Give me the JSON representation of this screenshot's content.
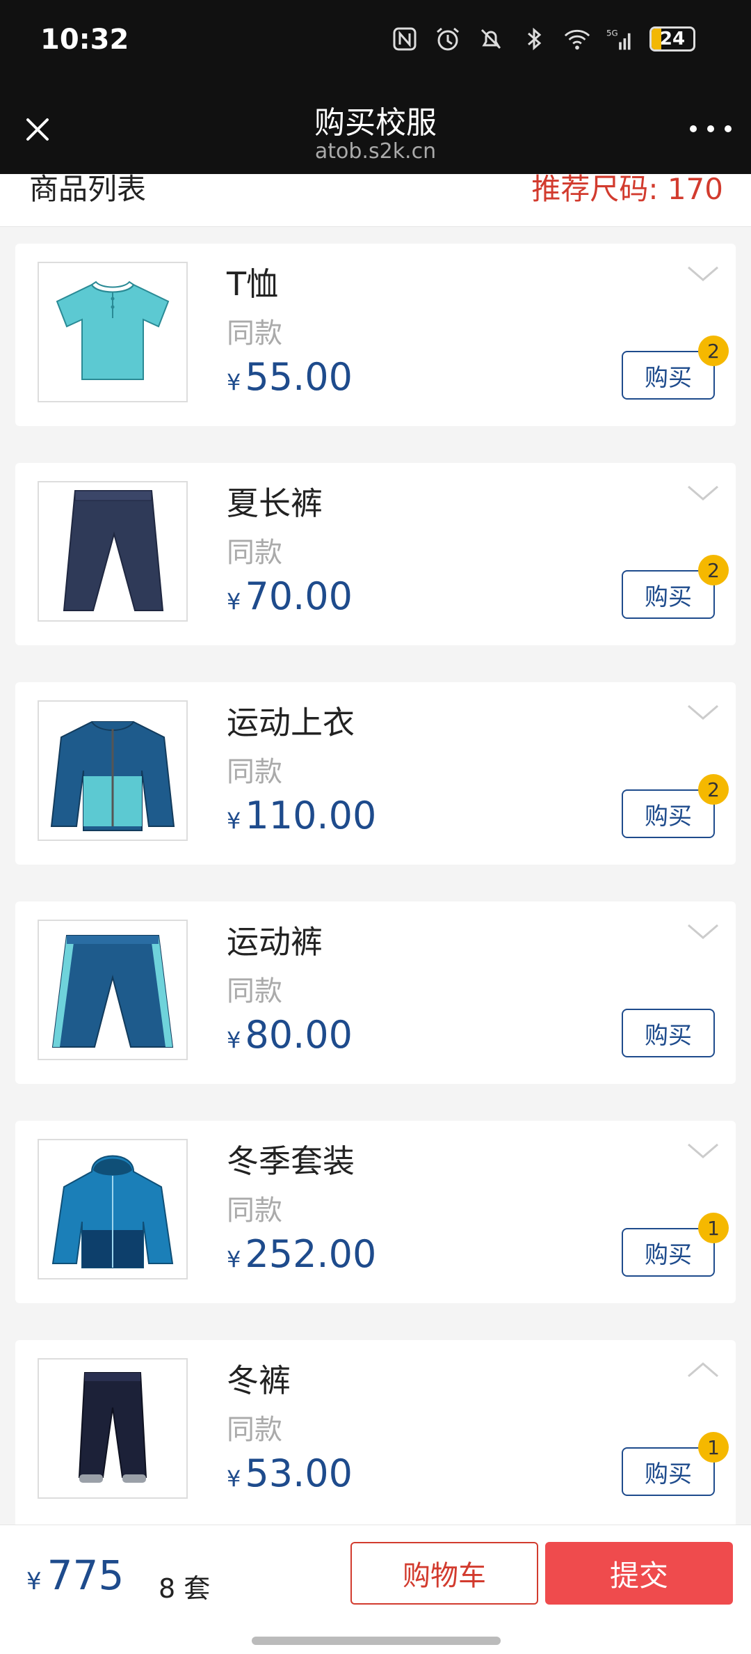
{
  "status_bar": {
    "time": "10:32",
    "battery": "24",
    "battery_level": 0.24,
    "icons": [
      "nfc-icon",
      "alarm-icon",
      "mute-icon",
      "bluetooth-icon",
      "wifi-icon",
      "signal-5g-icon"
    ]
  },
  "nav": {
    "title": "购买校服",
    "subtitle": "atob.s2k.cn"
  },
  "section": {
    "left": "商品列表",
    "right": "推荐尺码: 170"
  },
  "products": [
    {
      "name": "T恤",
      "variant": "同款",
      "currency": "¥",
      "price": "55.00",
      "buy": "购买",
      "badge": "2",
      "expanded": false
    },
    {
      "name": "夏长裤",
      "variant": "同款",
      "currency": "¥",
      "price": "70.00",
      "buy": "购买",
      "badge": "2",
      "expanded": false
    },
    {
      "name": "运动上衣",
      "variant": "同款",
      "currency": "¥",
      "price": "110.00",
      "buy": "购买",
      "badge": "2",
      "expanded": false
    },
    {
      "name": "运动裤",
      "variant": "同款",
      "currency": "¥",
      "price": "80.00",
      "buy": "购买",
      "badge": "",
      "expanded": false
    },
    {
      "name": "冬季套装",
      "variant": "同款",
      "currency": "¥",
      "price": "252.00",
      "buy": "购买",
      "badge": "1",
      "expanded": false
    },
    {
      "name": "冬裤",
      "variant": "同款",
      "currency": "¥",
      "price": "53.00",
      "buy": "购买",
      "badge": "1",
      "expanded": true
    }
  ],
  "bottom": {
    "currency": "¥",
    "total": "775",
    "count": "8 套",
    "cart": "购物车",
    "submit": "提交"
  },
  "colors": {
    "accent_blue": "#1e4b8c",
    "red": "#d23b2e",
    "badge": "#f5b800",
    "submit": "#ef4b4d"
  }
}
